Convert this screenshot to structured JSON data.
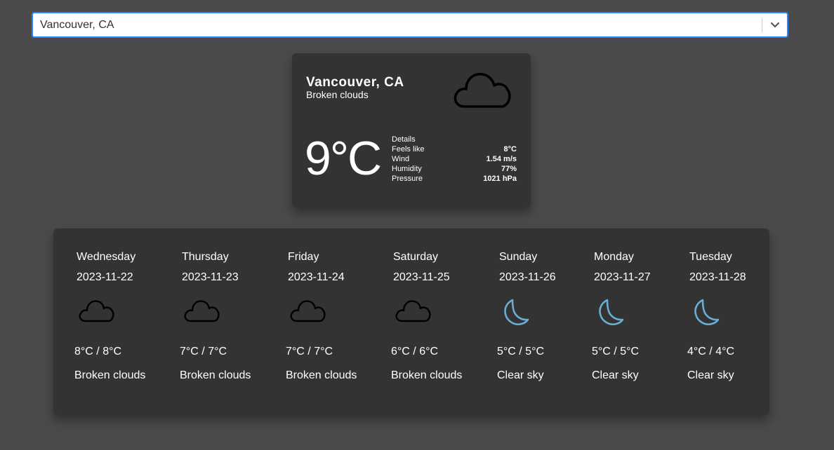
{
  "search": {
    "value": "Vancouver, CA",
    "dropdown_icon": "chevron-down-icon"
  },
  "current": {
    "city": "Vancouver, CA",
    "description": "Broken clouds",
    "icon": "cloud-icon",
    "temperature": "9°C",
    "details_label": "Details",
    "details": [
      {
        "label": "Feels like",
        "value": "8°C"
      },
      {
        "label": "Wind",
        "value": "1.54 m/s"
      },
      {
        "label": "Humidity",
        "value": "77%"
      },
      {
        "label": "Pressure",
        "value": "1021 hPa"
      }
    ]
  },
  "forecast": [
    {
      "day": "Wednesday",
      "date": "2023-11-22",
      "icon": "cloud-icon",
      "temp": "8°C / 8°C",
      "desc": "Broken clouds"
    },
    {
      "day": "Thursday",
      "date": "2023-11-23",
      "icon": "cloud-icon",
      "temp": "7°C / 7°C",
      "desc": "Broken clouds"
    },
    {
      "day": "Friday",
      "date": "2023-11-24",
      "icon": "cloud-icon",
      "temp": "7°C / 7°C",
      "desc": "Broken clouds"
    },
    {
      "day": "Saturday",
      "date": "2023-11-25",
      "icon": "cloud-icon",
      "temp": "6°C / 6°C",
      "desc": "Broken clouds"
    },
    {
      "day": "Sunday",
      "date": "2023-11-26",
      "icon": "moon-icon",
      "temp": "5°C / 5°C",
      "desc": "Clear sky"
    },
    {
      "day": "Monday",
      "date": "2023-11-27",
      "icon": "moon-icon",
      "temp": "5°C / 5°C",
      "desc": "Clear sky"
    },
    {
      "day": "Tuesday",
      "date": "2023-11-28",
      "icon": "moon-icon",
      "temp": "4°C / 4°C",
      "desc": "Clear sky"
    }
  ],
  "colors": {
    "background": "#4a4a4a",
    "card": "#333333",
    "select_border": "#2684ff",
    "moon": "#6aaed6"
  }
}
